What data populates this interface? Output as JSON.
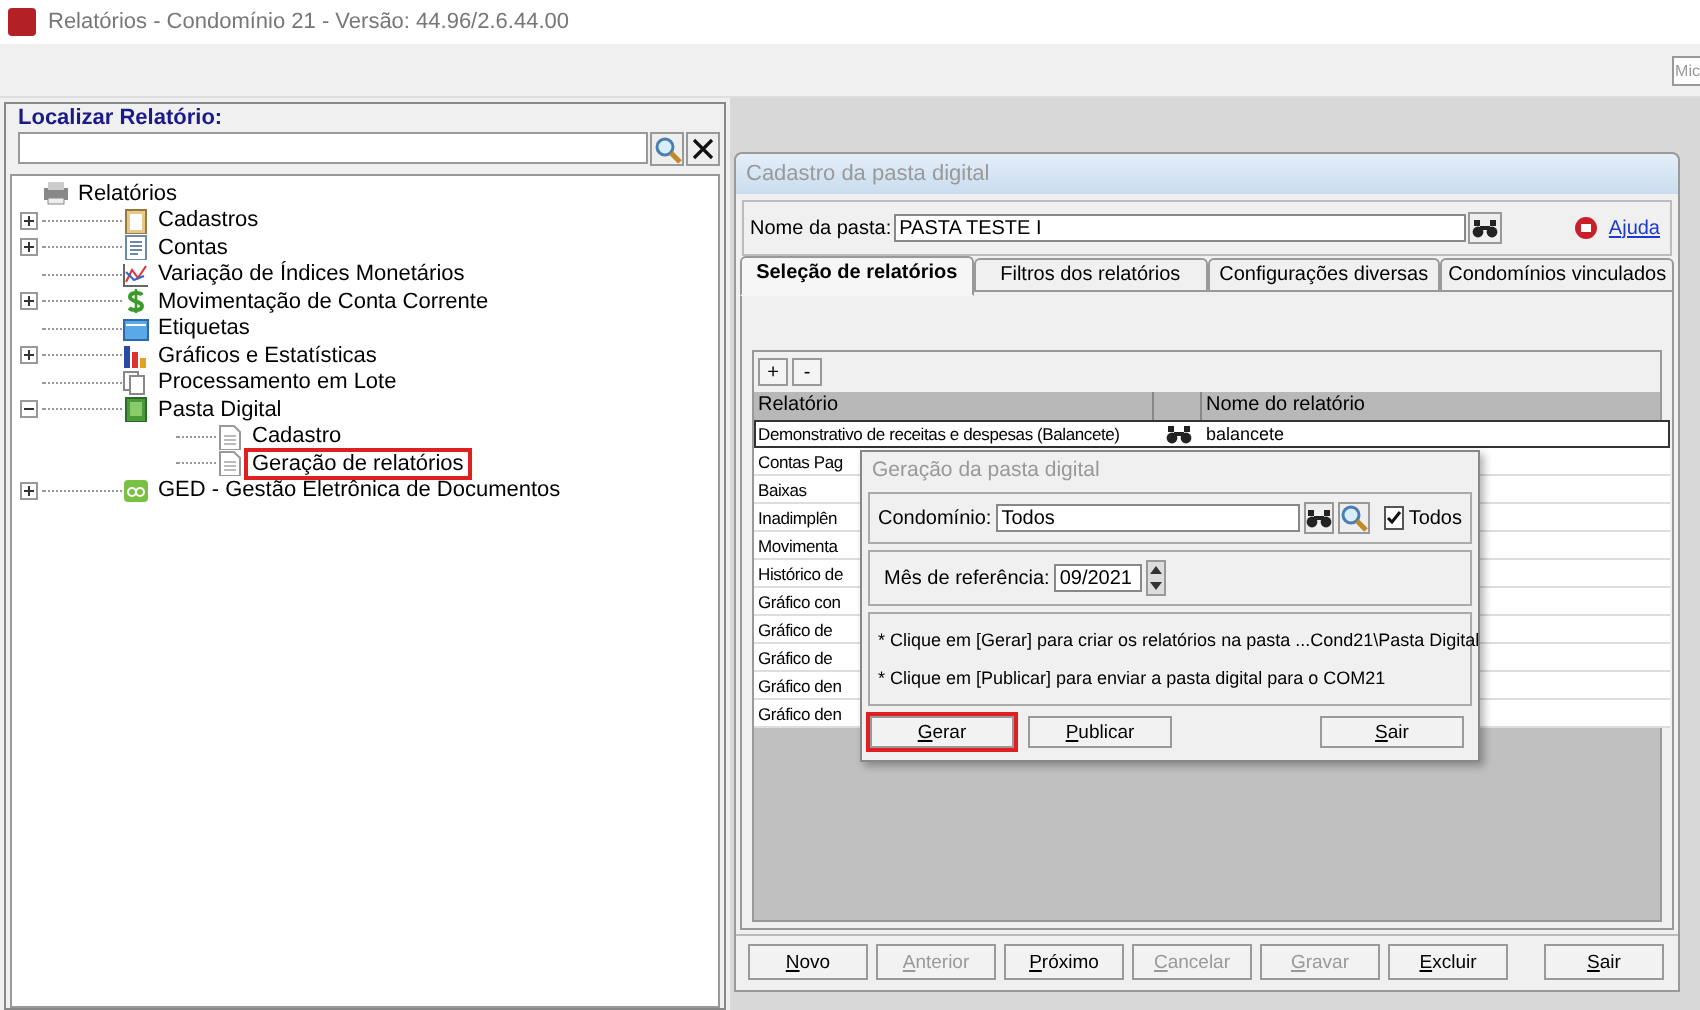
{
  "window": {
    "title": "Relatórios - Condomínio 21 - Versão: 44.96/2.6.44.00"
  },
  "toolbar": {
    "clipped_button": "Mic"
  },
  "report_finder": {
    "label": "Localizar Relatório:"
  },
  "tree": [
    {
      "label": "Relatórios",
      "kind": "printer",
      "highlighted": false,
      "children": [
        {
          "label": "Cadastros",
          "kind": "clipboard",
          "expandable": true,
          "expanded": false,
          "highlighted": false
        },
        {
          "label": "Contas",
          "kind": "sheet",
          "expandable": true,
          "expanded": false,
          "highlighted": false
        },
        {
          "label": "Variação de Índices Monetários",
          "kind": "linechart",
          "expandable": false,
          "highlighted": false
        },
        {
          "label": "Movimentação de Conta Corrente",
          "kind": "dollar",
          "expandable": true,
          "expanded": false,
          "highlighted": false
        },
        {
          "label": "Etiquetas",
          "kind": "label",
          "expandable": false,
          "highlighted": false
        },
        {
          "label": "Gráficos e Estatísticas",
          "kind": "barchart",
          "expandable": true,
          "expanded": false,
          "highlighted": false
        },
        {
          "label": "Processamento em Lote",
          "kind": "pages",
          "expandable": false,
          "highlighted": false
        },
        {
          "label": "Pasta Digital",
          "kind": "book",
          "expandable": true,
          "expanded": true,
          "highlighted": false,
          "children": [
            {
              "label": "Cadastro",
              "kind": "page",
              "expandable": false,
              "highlighted": false
            },
            {
              "label": "Geração de relatórios",
              "kind": "page",
              "expandable": false,
              "highlighted": true
            }
          ]
        },
        {
          "label": "GED - Gestão Eletrônica de Documentos",
          "kind": "ged",
          "expandable": true,
          "expanded": false,
          "highlighted": false
        }
      ]
    }
  ],
  "form_window": {
    "title": "Cadastro da pasta digital",
    "folder_name": {
      "label": "Nome da pasta:",
      "value": "PASTA TESTE I"
    },
    "help_link": "Ajuda",
    "tabs": [
      {
        "label": "Seleção de relatórios",
        "selected": true
      },
      {
        "label": "Filtros dos relatórios",
        "selected": false
      },
      {
        "label": "Configurações diversas",
        "selected": false
      },
      {
        "label": "Condomínios vinculados",
        "selected": false
      }
    ],
    "grid_buttons": [
      "+",
      "-"
    ],
    "grid": {
      "columns": [
        "Relatório",
        "Nome do relatório"
      ],
      "rows": [
        {
          "report": "Demonstrativo de receitas e despesas (Balancete)",
          "name": "balancete",
          "selected": true
        },
        {
          "report": "Contas Pag",
          "selected": false
        },
        {
          "report": "Baixas",
          "selected": false
        },
        {
          "report": "Inadimplên",
          "selected": false
        },
        {
          "report": "Movimenta",
          "selected": false
        },
        {
          "report": "Histórico de",
          "selected": false
        },
        {
          "report": "Gráfico con",
          "selected": false
        },
        {
          "report": "Gráfico de",
          "selected": false
        },
        {
          "report": "Gráfico de",
          "selected": false
        },
        {
          "report": "Gráfico den",
          "selected": false
        },
        {
          "report": "Gráfico den",
          "selected": false
        }
      ]
    },
    "buttons": [
      {
        "label": "Novo",
        "disabled": false
      },
      {
        "label": "Anterior",
        "disabled": true
      },
      {
        "label": "Próximo",
        "disabled": false
      },
      {
        "label": "Cancelar",
        "disabled": true
      },
      {
        "label": "Gravar",
        "disabled": true
      },
      {
        "label": "Excluir",
        "disabled": false
      },
      {
        "label": "Sair",
        "disabled": false
      }
    ]
  },
  "dialog": {
    "title": "Geração da pasta digital",
    "condominium": {
      "label": "Condomínio:",
      "value": "Todos",
      "all_label": "Todos",
      "all_checked": true
    },
    "reference_month": {
      "label": "Mês de referência:",
      "value": "09/2021"
    },
    "notes": [
      "* Clique em [Gerar] para criar os relatórios na pasta ...Cond21\\Pasta Digital",
      "* Clique em [Publicar] para enviar a pasta digital para o COM21"
    ],
    "buttons": [
      {
        "label": "Gerar",
        "highlighted": true
      },
      {
        "label": "Publicar",
        "highlighted": false
      },
      {
        "label": "Sair",
        "highlighted": false
      }
    ]
  }
}
